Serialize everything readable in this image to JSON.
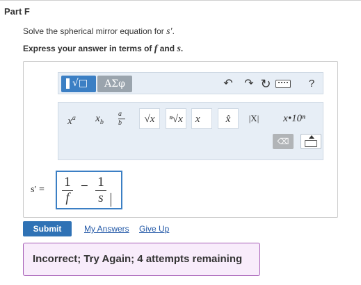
{
  "part": {
    "title": "Part F"
  },
  "instruction": {
    "prefix": "Solve the spherical mirror equation for ",
    "variable": "s′",
    "suffix": "."
  },
  "express": {
    "prefix": "Express your answer in terms of ",
    "var1": "f",
    "middle": " and ",
    "var2": "s",
    "suffix": "."
  },
  "toolbar": {
    "templates_glyph": "√□",
    "greek_label": "ΑΣφ",
    "undo_glyph": "↶",
    "redo_glyph": "↷",
    "reset_glyph": "↻",
    "help_label": "?",
    "symbols": [
      "x",
      "x",
      "a/b",
      "√x",
      "ⁿ√x",
      "x⃗",
      "x̂",
      "|X|",
      "x•10ⁿ"
    ]
  },
  "math": {
    "lhs": "s′ =",
    "term1": {
      "num": "1",
      "den": "f"
    },
    "operator": "−",
    "term2": {
      "num": "1",
      "den": "s"
    }
  },
  "actions": {
    "submit_label": "Submit",
    "my_answers_label": "My Answers",
    "give_up_label": "Give Up"
  },
  "feedback": {
    "text": "Incorrect; Try Again; 4 attempts remaining"
  }
}
